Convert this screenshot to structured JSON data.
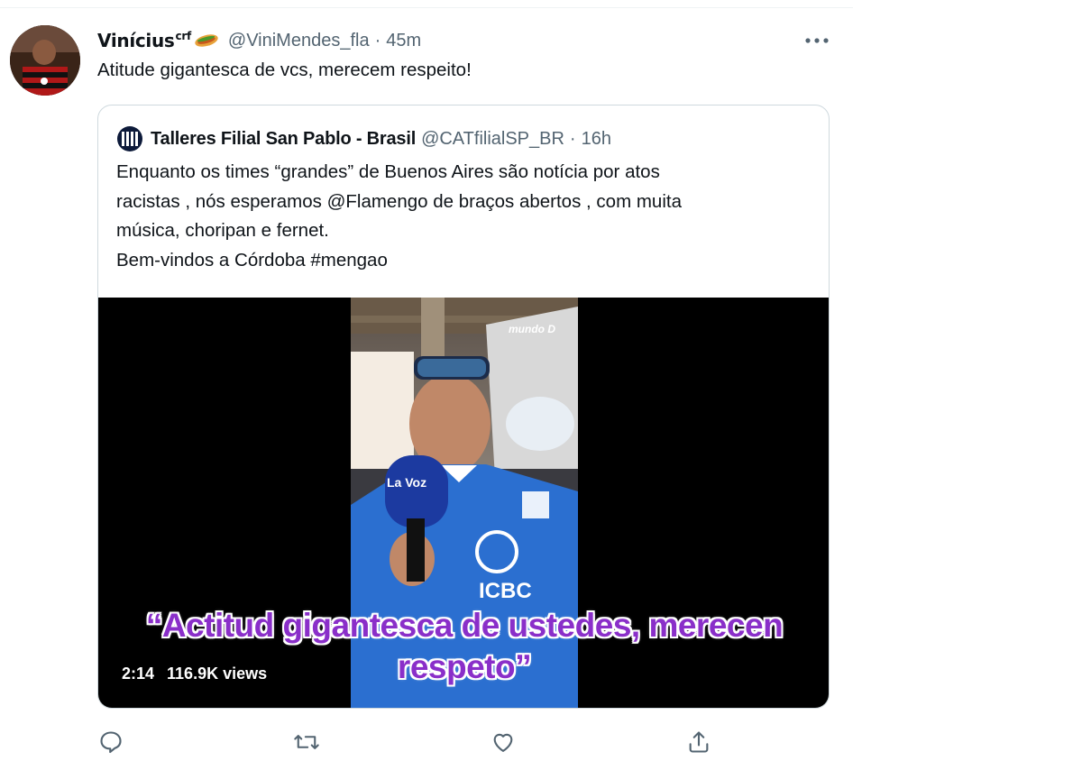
{
  "tweet": {
    "display_name": "Vinícius",
    "name_suffix": "crf",
    "handle": "@ViniMendes_fla",
    "separator": "·",
    "time": "45m",
    "text": "Atitude gigantesca de vcs, merecem respeito!",
    "more_icon": "more-horizontal-icon",
    "emoji": "sandwich-emoji"
  },
  "quote": {
    "display_name": "Talleres Filial San Pablo - Brasil",
    "handle": "@CATfilialSP_BR",
    "separator": "·",
    "time": "16h",
    "lines": [
      "Enquanto os times “grandes” de Buenos Aires são notícia por atos",
      "racistas , nós esperamos @Flamengo de braços abertos , com muita",
      "música, choripan e fernet.",
      "Bem-vindos a Córdoba #mengao"
    ],
    "video": {
      "watermark": "mundo D",
      "subtitle_line1": "“Actitud gigantesca de ustedes, merecen",
      "subtitle_line2": "respeto”",
      "duration": "2:14",
      "views": "116.9K views",
      "mic_label": "La Voz",
      "shirt_sponsor": "ICBC"
    }
  },
  "actions": {
    "reply_icon": "reply-icon",
    "retweet_icon": "retweet-icon",
    "like_icon": "heart-icon",
    "share_icon": "share-icon"
  },
  "colors": {
    "text_primary": "#0f1419",
    "text_secondary": "#536471",
    "border": "#cfd9de",
    "subtitle": "#8a2fc9"
  }
}
